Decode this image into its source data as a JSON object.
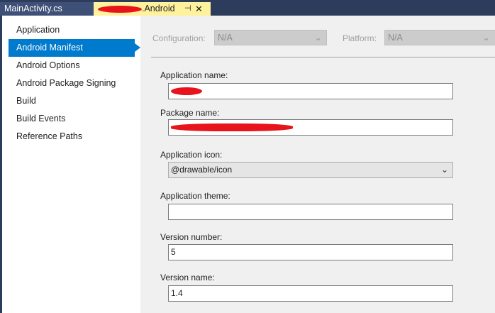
{
  "tabs": [
    {
      "label": "MainActivity.cs",
      "active": false
    },
    {
      "label": ".Android",
      "active": true,
      "pin_icon": "pin-icon",
      "close_icon": "close-icon"
    }
  ],
  "sidebar": {
    "items": [
      {
        "label": "Application"
      },
      {
        "label": "Android Manifest",
        "selected": true
      },
      {
        "label": "Android Options"
      },
      {
        "label": "Android Package Signing"
      },
      {
        "label": "Build"
      },
      {
        "label": "Build Events"
      },
      {
        "label": "Reference Paths"
      }
    ]
  },
  "config": {
    "configuration_label": "Configuration:",
    "configuration_value": "N/A",
    "platform_label": "Platform:",
    "platform_value": "N/A"
  },
  "form": {
    "app_name_label": "Application name:",
    "package_name_label": "Package name:",
    "app_icon_label": "Application icon:",
    "app_icon_value": "@drawable/icon",
    "app_theme_label": "Application theme:",
    "app_theme_value": "",
    "version_number_label": "Version number:",
    "version_number_value": "5",
    "version_name_label": "Version name:",
    "version_name_value": "1.4"
  },
  "colors": {
    "accent": "#007acc",
    "active_tab": "#fff29d",
    "tabbar": "#2d3c5a"
  }
}
